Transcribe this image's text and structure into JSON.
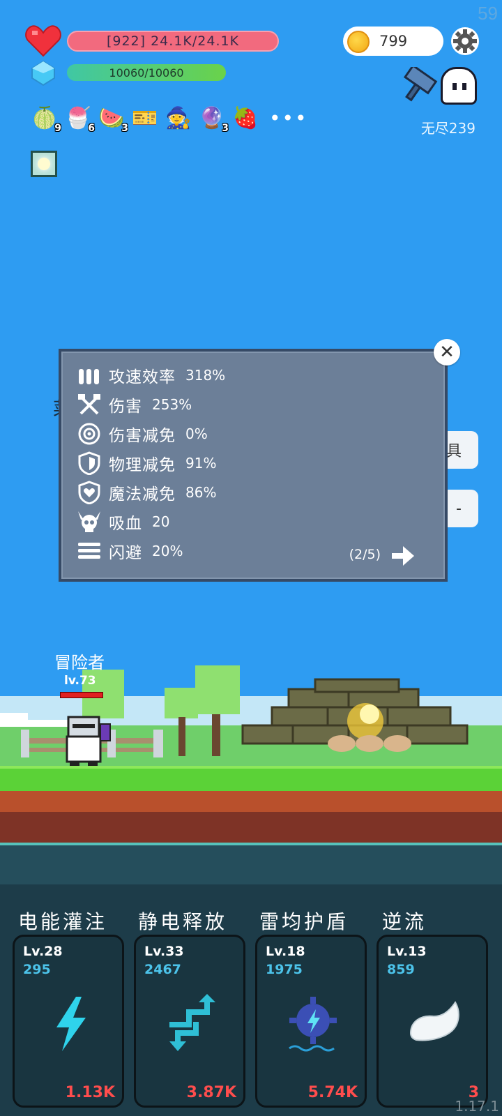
{
  "hud": {
    "fps": "59",
    "hp_text": "[922] 24.1K/24.1K",
    "mp_text": "10060/10060",
    "gold": "799",
    "stage": "无尽239"
  },
  "items": [
    {
      "icon": "melon-icon",
      "glyph": "🍈",
      "count": "9"
    },
    {
      "icon": "ice-cream-icon",
      "glyph": "🍧",
      "count": "6"
    },
    {
      "icon": "watermelon-icon",
      "glyph": "🍉",
      "count": "3"
    },
    {
      "icon": "ticket-icon",
      "glyph": "🎫",
      "count": ""
    },
    {
      "icon": "wizard-hat-icon",
      "glyph": "🧙",
      "count": ""
    },
    {
      "icon": "crystal-ball-icon",
      "glyph": "🔮",
      "count": "3"
    },
    {
      "icon": "strawberry-icon",
      "glyph": "🍓",
      "count": ""
    }
  ],
  "more_label": "•••",
  "stats_panel": {
    "rows": [
      {
        "label": "攻速效率",
        "value": "318%"
      },
      {
        "label": "伤害",
        "value": "253%"
      },
      {
        "label": "伤害减免",
        "value": "0%"
      },
      {
        "label": "物理减免",
        "value": "91%"
      },
      {
        "label": "魔法减免",
        "value": "86%"
      },
      {
        "label": "吸血",
        "value": "20"
      },
      {
        "label": "闪避",
        "value": "20%"
      }
    ],
    "pager": "(2/5)",
    "close_label": "✕"
  },
  "hero": {
    "name": "冒险者",
    "level": "lv.73"
  },
  "behind": {
    "left_char": "菜",
    "btn1": "具",
    "btn2": "-"
  },
  "skills": [
    {
      "title": "电能灌注",
      "level": "Lv.28",
      "points": "295",
      "cost": "1.13K"
    },
    {
      "title": "静电释放",
      "level": "Lv.33",
      "points": "2467",
      "cost": "3.87K"
    },
    {
      "title": "雷均护盾",
      "level": "Lv.18",
      "points": "1975",
      "cost": "5.74K"
    },
    {
      "title": "逆流",
      "level": "Lv.13",
      "points": "859",
      "cost": "3"
    }
  ],
  "version": "1.17.1",
  "colors": {
    "sky": "#2e9cf2",
    "hp": "#f26a7e",
    "panel": "#6c7f98",
    "skill_points": "#4cc3ea",
    "cost": "#ff4d4d"
  }
}
